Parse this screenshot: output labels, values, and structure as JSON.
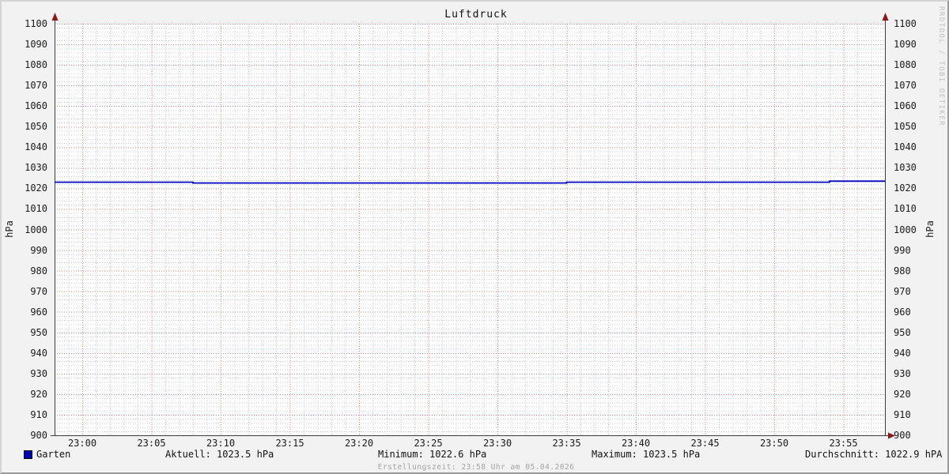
{
  "chart_data": {
    "type": "line",
    "title": "Luftdruck",
    "y_axis": {
      "label": "hPa",
      "min": 900,
      "max": 1100,
      "tick_step": 10,
      "minor_step": 2,
      "ticks": [
        900,
        910,
        920,
        930,
        940,
        950,
        960,
        970,
        980,
        990,
        1000,
        1010,
        1020,
        1030,
        1040,
        1050,
        1060,
        1070,
        1080,
        1090,
        1100
      ]
    },
    "x_axis": {
      "start_time": "22:58",
      "end_time": "23:58",
      "duration_min": 60,
      "tick_interval_min": 5,
      "minor_interval_min": 1,
      "first_tick_offset_min": 2,
      "tick_labels": [
        "23:00",
        "23:05",
        "23:10",
        "23:15",
        "23:20",
        "23:25",
        "23:30",
        "23:35",
        "23:40",
        "23:45",
        "23:50",
        "23:55"
      ]
    },
    "series": [
      {
        "name": "Garten",
        "unit": "hPa",
        "color": "#0000c0",
        "segments_min_value": [
          [
            0,
            10,
            1023.0
          ],
          [
            10,
            37,
            1022.6
          ],
          [
            37,
            56,
            1023.0
          ],
          [
            56,
            60,
            1023.5
          ]
        ]
      }
    ],
    "stats": {
      "aktuell": "Aktuell: 1023.5 hPa",
      "minimum": "Minimum: 1022.6 hPa",
      "maximum": "Maximum: 1023.5 hPa",
      "durchschnitt": "Durchschnitt: 1022.9 hPA"
    },
    "footer": "Erstellungszeit: 23:58 Uhr am 05.04.2026",
    "watermark": "RRDTOOL / TOBI OETIKER",
    "legend_position": "bottom",
    "grid": true,
    "colors": {
      "line": "#0000c0",
      "legend_box": "#0000b4",
      "grid_major": "#e98585",
      "grid_minor": "#d2d2d2",
      "axis": "#3b3b3b",
      "arrow": "#8c1717",
      "background": "#f2f2f2",
      "canvas": "#ffffff",
      "text": "#1a1a1a",
      "muted": "#a3a3a3",
      "watermark": "#bfbfbf"
    }
  }
}
